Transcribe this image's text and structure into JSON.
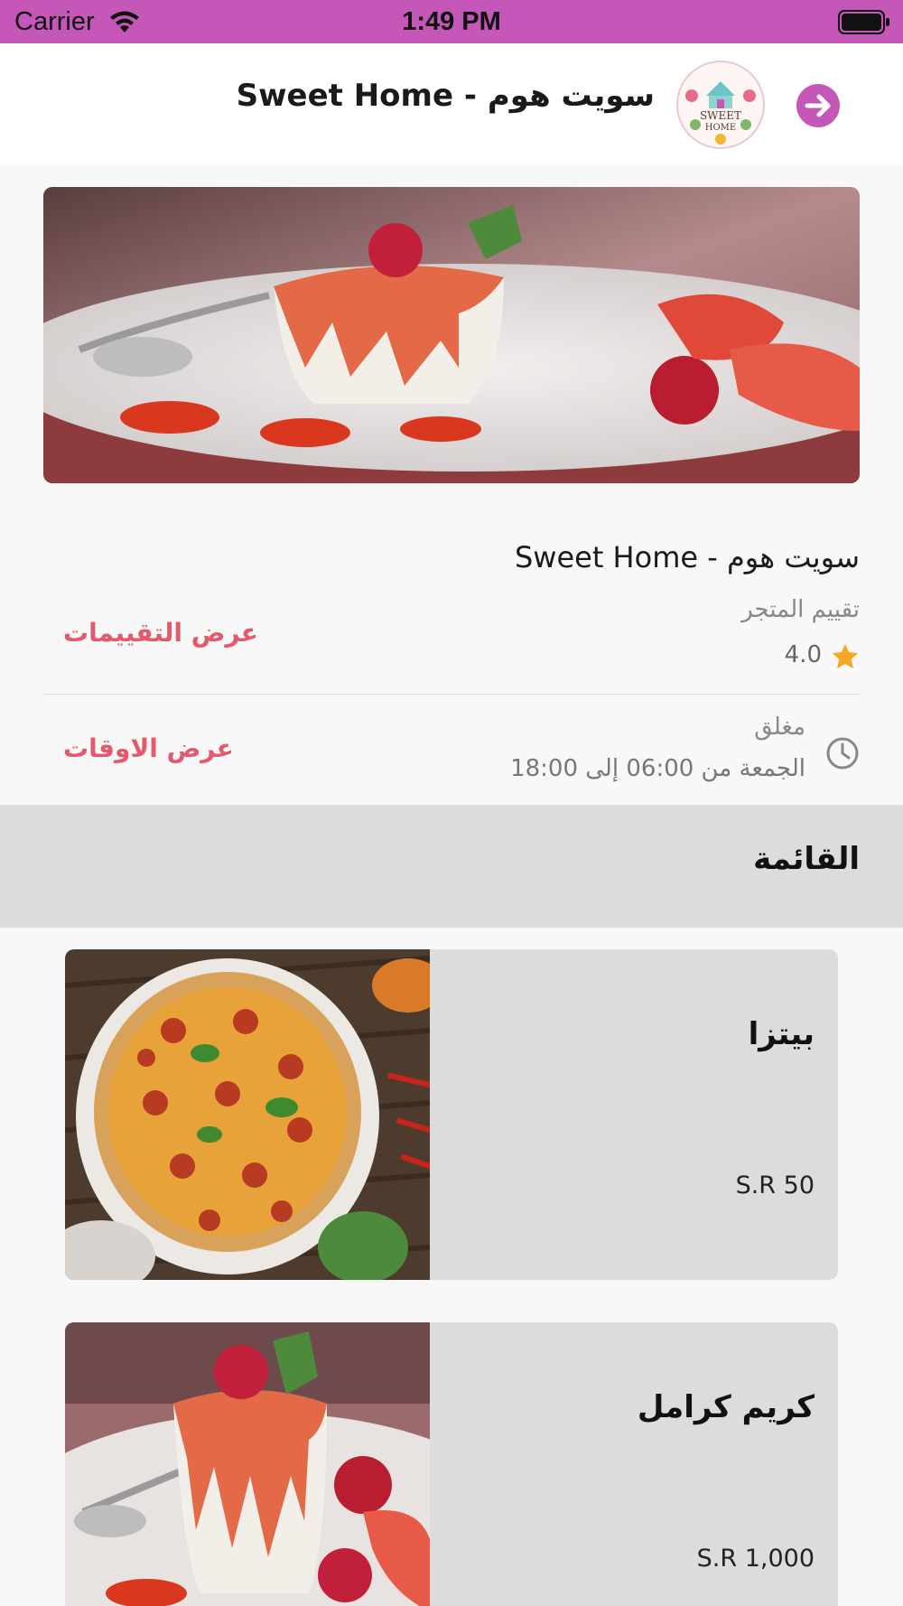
{
  "status_bar": {
    "carrier": "Carrier",
    "time": "1:49 PM"
  },
  "header": {
    "title": "سويت هوم - Sweet Home",
    "logo_text": "SWEET HOME",
    "back_icon": "arrow-right-icon",
    "accent_color": "#c457b8"
  },
  "store": {
    "name": "سويت هوم - Sweet Home",
    "rating_label": "تقييم المتجر",
    "rating_value": "4.0",
    "reviews_link": "عرض التقييمات",
    "status": "مغلق",
    "hours": "الجمعة من 06:00 إلى 18:00",
    "hours_link": "عرض الاوقات",
    "link_color": "#e35a6c",
    "star_color": "#f5a623"
  },
  "menu": {
    "title": "القائمة",
    "items": [
      {
        "name": "بيتزا",
        "price": "S.R 50",
        "image": "pizza"
      },
      {
        "name": "كريم كرامل",
        "price": "S.R 1,000",
        "image": "panna-cotta"
      }
    ]
  }
}
